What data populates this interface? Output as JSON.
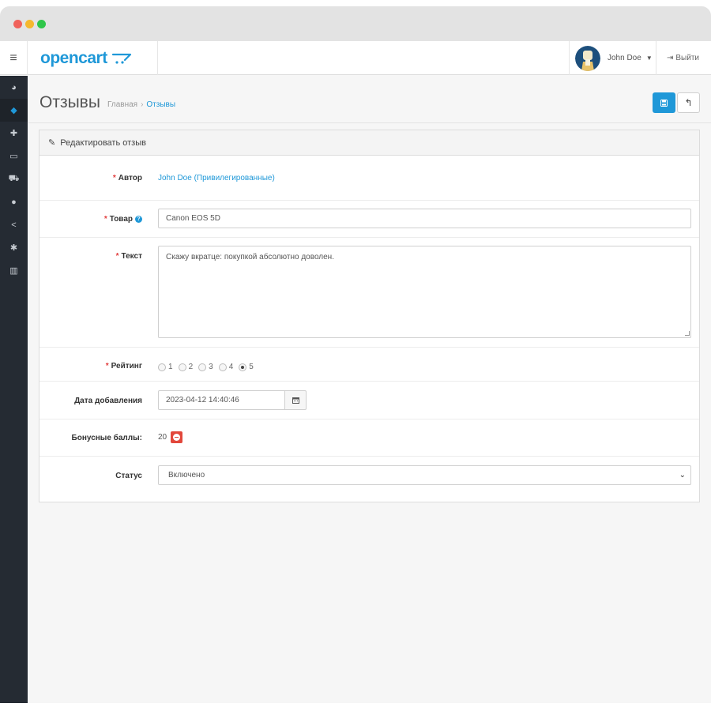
{
  "app": {
    "logo_text": "opencart",
    "menu_icon": "hamburger-icon"
  },
  "user": {
    "name": "John Doe",
    "logout_label": "Выйти"
  },
  "sidebar": {
    "items": [
      {
        "icon": "dashboard-icon",
        "glyph": "◕",
        "active": false
      },
      {
        "icon": "tags-icon",
        "glyph": "◆",
        "active": true
      },
      {
        "icon": "puzzle-icon",
        "glyph": "✚",
        "active": false
      },
      {
        "icon": "monitor-icon",
        "glyph": "▭",
        "active": false
      },
      {
        "icon": "cart-icon",
        "glyph": "⛟",
        "active": false
      },
      {
        "icon": "user-icon",
        "glyph": "●",
        "active": false
      },
      {
        "icon": "share-icon",
        "glyph": "<",
        "active": false
      },
      {
        "icon": "cog-icon",
        "glyph": "✱",
        "active": false
      },
      {
        "icon": "bar-chart-icon",
        "glyph": "▥",
        "active": false
      }
    ]
  },
  "page": {
    "title": "Отзывы",
    "breadcrumb_home": "Главная",
    "breadcrumb_separator": "›",
    "breadcrumb_current": "Отзывы"
  },
  "panel": {
    "heading": "Редактировать отзыв"
  },
  "form": {
    "author_label": "Автор",
    "author_value": "John Doe (Привилегированные)",
    "product_label": "Товар",
    "product_value": "Canon EOS 5D",
    "text_label": "Текст",
    "text_value": "Скажу вкратце: покупкой абсолютно доволен.",
    "rating_label": "Рейтинг",
    "rating_options": [
      "1",
      "2",
      "3",
      "4",
      "5"
    ],
    "rating_selected": "5",
    "date_label": "Дата добавления",
    "date_value": "2023-04-12 14:40:46",
    "bonus_label": "Бонусные баллы:",
    "bonus_value": "20",
    "status_label": "Статус",
    "status_value": "Включено"
  },
  "colors": {
    "accent": "#1f98d8",
    "sidebar_bg": "#252b33",
    "danger": "#e2473b",
    "required": "#e23c3c"
  }
}
